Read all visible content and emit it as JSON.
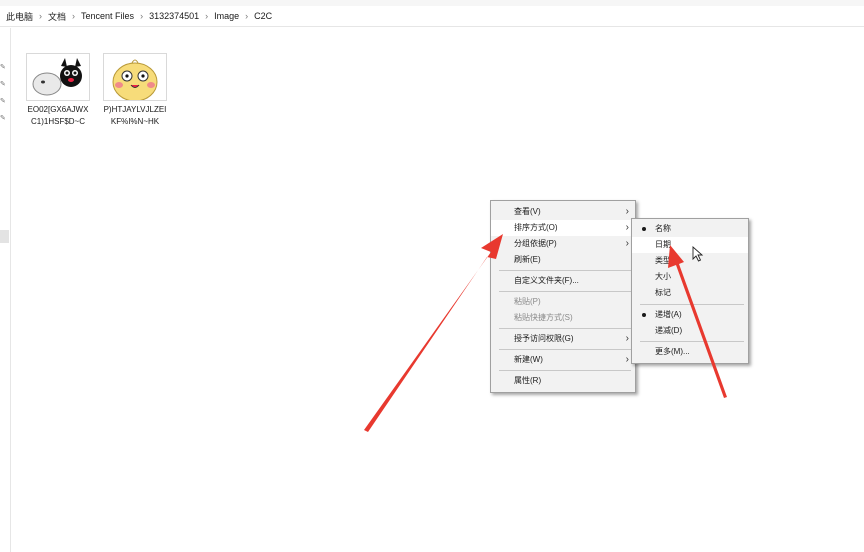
{
  "breadcrumb": [
    "此电脑",
    "文档",
    "Tencent Files",
    "3132374501",
    "Image",
    "C2C"
  ],
  "files": [
    {
      "name": "EO02[GX6AJWXC1)1HSF$D~C",
      "line1": "EO02[GX6AJWX",
      "line2": "C1)1HSF$D~C"
    },
    {
      "name": "P)HTJAYLVJLZEIKF%I%N~HK",
      "line1": "P)HTJAYLVJLZEI",
      "line2": "KF%I%N~HK"
    }
  ],
  "context_menu": {
    "items": [
      {
        "label": "查看(V)",
        "submenu": true
      },
      {
        "label": "排序方式(O)",
        "submenu": true,
        "highlighted": true
      },
      {
        "label": "分组依据(P)",
        "submenu": true
      },
      {
        "label": "刷新(E)"
      },
      {
        "label": "自定义文件夹(F)..."
      },
      {
        "label": "粘贴(P)",
        "disabled": true
      },
      {
        "label": "粘贴快捷方式(S)",
        "disabled": true
      },
      {
        "label": "授予访问权限(G)",
        "submenu": true
      },
      {
        "label": "新建(W)",
        "submenu": true
      },
      {
        "label": "属性(R)"
      }
    ]
  },
  "sort_submenu": {
    "items": [
      {
        "label": "名称",
        "selected": true
      },
      {
        "label": "日期",
        "highlighted": true
      },
      {
        "label": "类型"
      },
      {
        "label": "大小"
      },
      {
        "label": "标记"
      },
      {
        "label": "递增(A)",
        "selected": true
      },
      {
        "label": "递减(D)"
      },
      {
        "label": "更多(M)..."
      }
    ]
  },
  "colors": {
    "annotation_arrow": "#e8392f",
    "menu_bg": "#f2f2f2",
    "menu_border": "#a0a0a0"
  },
  "icons": [
    "chevron-right-icon",
    "pin-icon",
    "mouse-pointer-icon",
    "bullet-icon"
  ]
}
